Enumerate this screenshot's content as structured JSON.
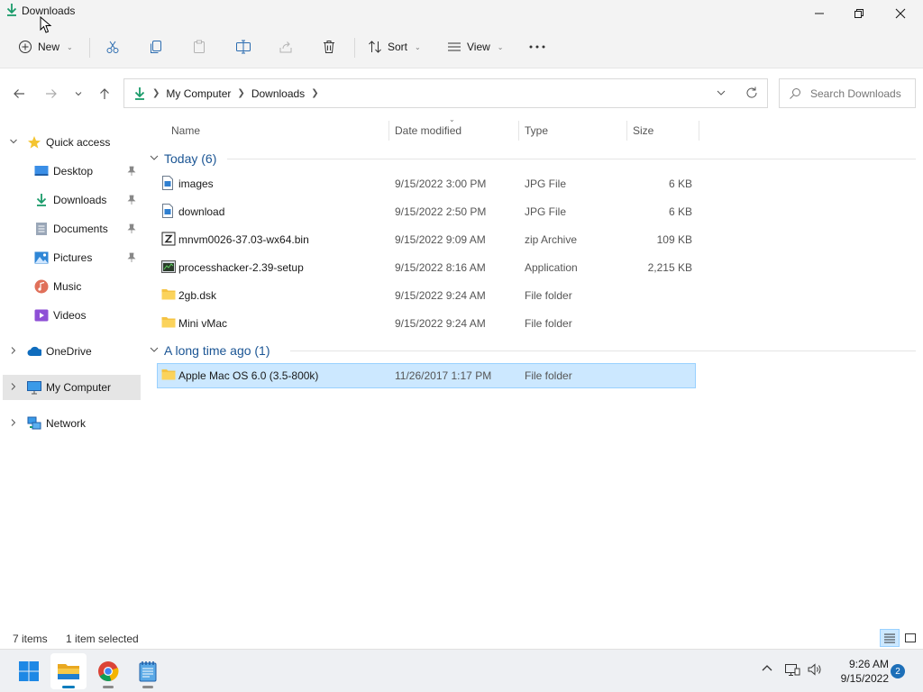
{
  "window": {
    "title": "Downloads",
    "controls": [
      "minimize",
      "maximize",
      "close"
    ]
  },
  "toolbar": {
    "new_label": "New",
    "sort_label": "Sort",
    "view_label": "View",
    "actions": [
      "cut",
      "copy",
      "paste",
      "rename",
      "share",
      "delete",
      "more"
    ]
  },
  "address": {
    "crumbs": [
      "My Computer",
      "Downloads"
    ],
    "search_placeholder": "Search Downloads"
  },
  "sidebar": {
    "quick_access": "Quick access",
    "pinned": [
      {
        "label": "Desktop",
        "icon": "desktop-icon",
        "pinned": true
      },
      {
        "label": "Downloads",
        "icon": "download-arrow-icon",
        "pinned": true
      },
      {
        "label": "Documents",
        "icon": "document-icon",
        "pinned": true
      },
      {
        "label": "Pictures",
        "icon": "picture-icon",
        "pinned": true
      },
      {
        "label": "Music",
        "icon": "music-icon",
        "pinned": false
      },
      {
        "label": "Videos",
        "icon": "video-icon",
        "pinned": false
      }
    ],
    "onedrive": "OneDrive",
    "my_computer": "My Computer",
    "network": "Network"
  },
  "columns": {
    "name": "Name",
    "date": "Date modified",
    "type": "Type",
    "size": "Size"
  },
  "groups": [
    {
      "label": "Today (6)",
      "files": [
        {
          "name": "images",
          "date": "9/15/2022 3:00 PM",
          "type": "JPG File",
          "size": "6 KB",
          "icon": "image-file-icon"
        },
        {
          "name": "download",
          "date": "9/15/2022 2:50 PM",
          "type": "JPG File",
          "size": "6 KB",
          "icon": "image-file-icon"
        },
        {
          "name": "mnvm0026-37.03-wx64.bin",
          "date": "9/15/2022 9:09 AM",
          "type": "zip Archive",
          "size": "109 KB",
          "icon": "zip-archive-icon"
        },
        {
          "name": "processhacker-2.39-setup",
          "date": "9/15/2022 8:16 AM",
          "type": "Application",
          "size": "2,215 KB",
          "icon": "application-icon"
        },
        {
          "name": "2gb.dsk",
          "date": "9/15/2022 9:24 AM",
          "type": "File folder",
          "size": "",
          "icon": "folder-icon"
        },
        {
          "name": "Mini vMac",
          "date": "9/15/2022 9:24 AM",
          "type": "File folder",
          "size": "",
          "icon": "folder-icon"
        }
      ]
    },
    {
      "label": "A long time ago (1)",
      "files": [
        {
          "name": "Apple Mac OS 6.0 (3.5-800k)",
          "date": "11/26/2017 1:17 PM",
          "type": "File folder",
          "size": "",
          "icon": "folder-icon",
          "selected": true
        }
      ]
    }
  ],
  "status": {
    "item_count": "7 items",
    "selection": "1 item selected"
  },
  "taskbar": {
    "apps": [
      "start-icon",
      "file-explorer-icon",
      "chrome-icon",
      "notepad-icon"
    ],
    "clock_time": "9:26 AM",
    "clock_date": "9/15/2022",
    "notification_count": "2"
  },
  "colors": {
    "accent": "#0a7cbd",
    "selection_bg": "#cce8ff",
    "selection_border": "#99d1ff",
    "group_header": "#1b5594",
    "folder": "#f5c342"
  }
}
